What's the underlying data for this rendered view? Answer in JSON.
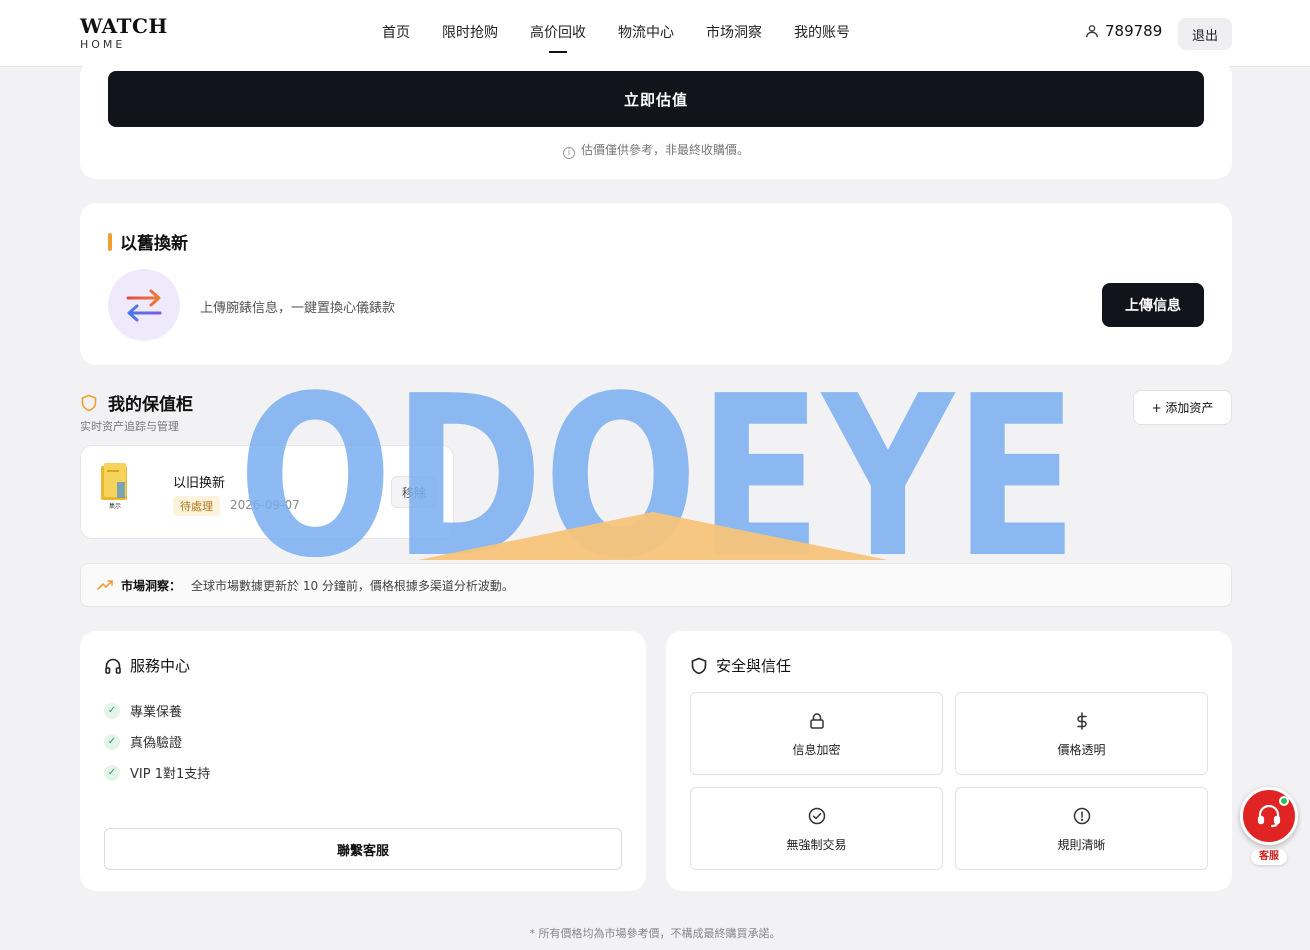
{
  "header": {
    "logo_main": "WATCH",
    "logo_sub": "HOME",
    "nav": [
      "首页",
      "限时抢购",
      "高价回收",
      "物流中心",
      "市场洞察",
      "我的账号"
    ],
    "active_nav": "高价回收",
    "username": "789789",
    "logout_label": "退出"
  },
  "estimate": {
    "button_label": "立即估值",
    "note": "估價僅供參考，非最終收購價。"
  },
  "trade_in": {
    "title": "以舊換新",
    "description": "上傳腕錶信息，一鍵置換心儀錶款",
    "upload_label": "上傳信息"
  },
  "vault": {
    "title": "我的保值柜",
    "subtitle": "实时资产追踪与管理",
    "add_label": "+ 添加资产",
    "assets": [
      {
        "thumb_label": "集示",
        "name": "以旧换新",
        "status": "待處理",
        "date": "2026-09-07",
        "remove_label": "移除"
      }
    ]
  },
  "watermark": {
    "text": "ODOEYE"
  },
  "market": {
    "label": "市場洞察：",
    "text": "全球市場數據更新於 10 分鐘前，價格根據多渠道分析波動。"
  },
  "service": {
    "title": "服務中心",
    "items": [
      "專業保養",
      "真偽驗證",
      "VIP 1對1支持"
    ],
    "contact_label": "聯繫客服"
  },
  "security": {
    "title": "安全與信任",
    "tiles": [
      {
        "icon": "lock-icon",
        "label": "信息加密"
      },
      {
        "icon": "dollar-icon",
        "label": "價格透明"
      },
      {
        "icon": "check-circle-icon",
        "label": "無強制交易"
      },
      {
        "icon": "alert-circle-icon",
        "label": "規則清晰"
      }
    ]
  },
  "footer": {
    "note": "* 所有價格均為市場參考價，不構成最終購買承諾。"
  },
  "support": {
    "label": "客服"
  },
  "colors": {
    "accent": "#f0a030",
    "primary_dark": "#12141b",
    "support_red": "#e02424",
    "watermark_blue": "#7aaef0",
    "watermark_orange": "#f7c37a"
  }
}
